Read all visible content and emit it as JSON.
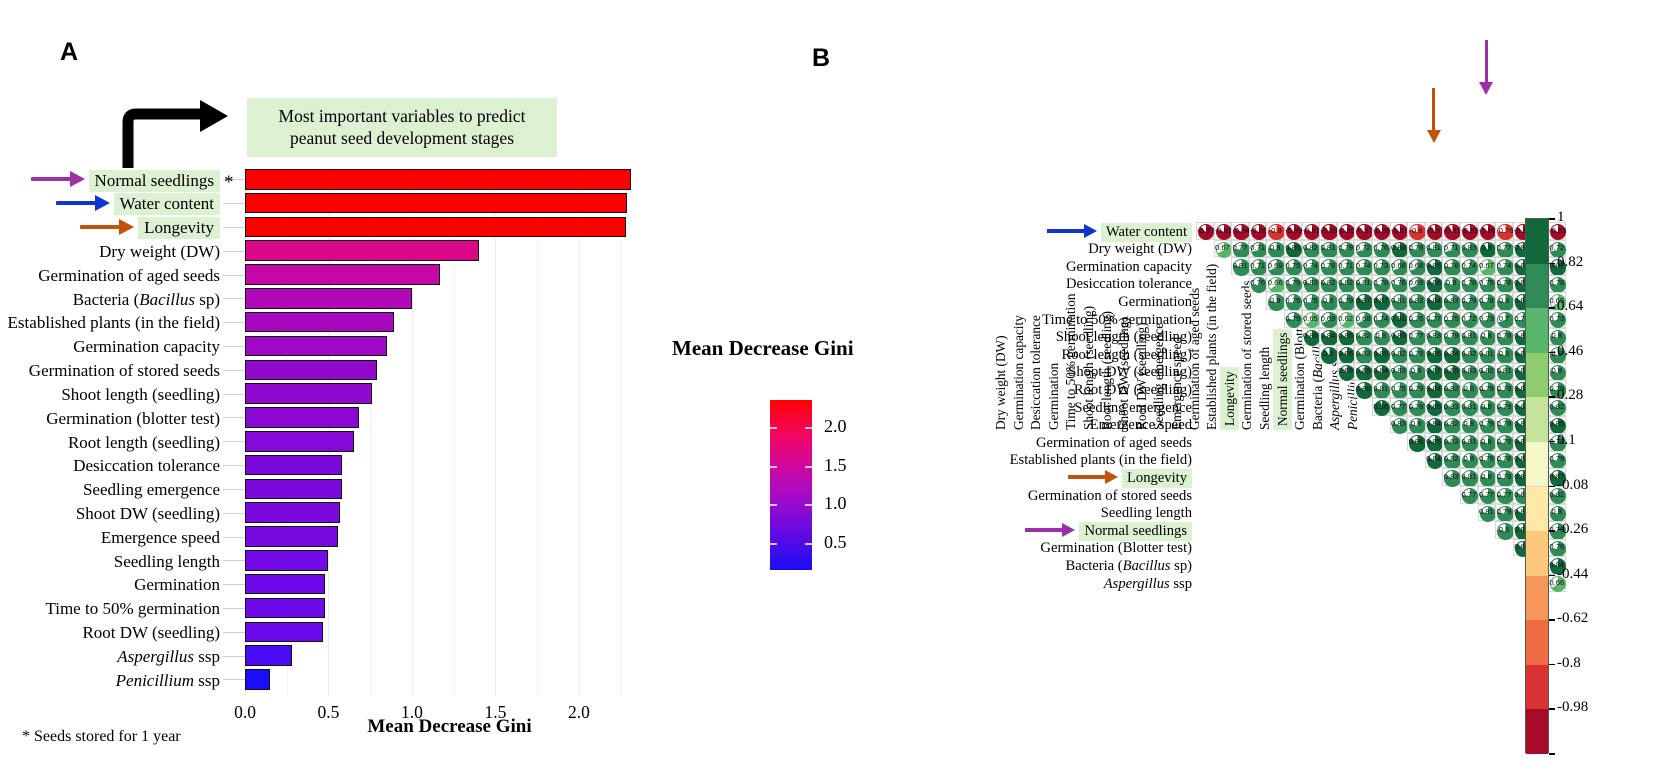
{
  "panelA": {
    "letter": "A",
    "callout_text_line1": "Most important variables to predict",
    "callout_text_line2": "peanut seed development stages",
    "axis_title": "Mean Decrease Gini",
    "footnote": "* Seeds stored for 1 year",
    "asterisk": "*",
    "xticks": [
      "0.0",
      "0.5",
      "1.0",
      "1.5",
      "2.0"
    ],
    "arrows": [
      {
        "name": "purple-arrow-normal-seedlings",
        "color": "#9B30A8"
      },
      {
        "name": "blue-arrow-water-content",
        "color": "#0E35D0"
      },
      {
        "name": "orange-arrow-longevity",
        "color": "#C1520A"
      }
    ]
  },
  "legend": {
    "title": "Mean Decrease Gini",
    "ticks": [
      "2.0",
      "1.5",
      "1.0",
      "0.5"
    ]
  },
  "panelB": {
    "letter": "B",
    "col_headers": [
      "Dry weight (DW)",
      "Germination capacity",
      "Desiccation tolerance",
      "Germination",
      "Time to 50% germination",
      "Shoot length (seedling)",
      "Root length (seedling)",
      "Shoot DW (seedling)",
      "Root DW (seedling)",
      "Seedling emergence",
      "Emergence speed",
      "Germination of aged seeds",
      "Established plants (in the field)",
      "Longevity",
      "Germination of stored seeds",
      "Seedling length",
      "Normal seedlings",
      "Germination (Blotter test)",
      "Bacteria (Bacillus sp)",
      "Aspergillus ssp",
      "Penicillium ssp"
    ],
    "col_header_italic": {
      "18": "Bacillus",
      "19": "Aspergillus",
      "20": "Penicillium"
    },
    "col_highlight": [
      13,
      16
    ],
    "row_labels": [
      "Water content",
      "Dry weight (DW)",
      "Germination capacity",
      "Desiccation tolerance",
      "Germination",
      "Time to 50% germination",
      "Shoot length (seedling)",
      "Root length (seedling)",
      "Shoot DW (seedling)",
      "Root DW (seedling)",
      "Seedling emergence",
      "Emergence speed",
      "Germination of aged seeds",
      "Established plants (in the field)",
      "Longevity",
      "Germination of stored seeds",
      "Seedling length",
      "Normal seedlings",
      "Germination (Blotter test)",
      "Bacteria (Bacillus sp)",
      "Aspergillus ssp"
    ],
    "row_highlight": [
      0,
      14,
      17
    ],
    "arrows": [
      {
        "name": "blue-arrow-water-content-row",
        "color": "#0E35D0"
      },
      {
        "name": "orange-arrow-longevity-row",
        "color": "#C1520A"
      },
      {
        "name": "purple-arrow-normal-seedlings-row",
        "color": "#9B30A8"
      },
      {
        "name": "orange-arrow-longevity-col",
        "color": "#C1520A"
      },
      {
        "name": "purple-arrow-normal-seedlings-col",
        "color": "#9B30A8"
      }
    ],
    "scale_ticks": [
      "1",
      "0.82",
      "0.64",
      "0.46",
      "0.28",
      "0.1",
      "-0.08",
      "-0.26",
      "-0.44",
      "-0.62",
      "-0.8",
      "-0.98"
    ],
    "scale_colors": [
      "#11693B",
      "#2E8B57",
      "#59B56B",
      "#8FCB6F",
      "#C6E39C",
      "#F5F7C6",
      "#FCE9A8",
      "#FBC87C",
      "#F79659",
      "#EE6B43",
      "#D93232",
      "#A50B28"
    ]
  },
  "chart_data": [
    {
      "type": "bar",
      "title": "Most important variables to predict peanut seed development stages",
      "xlabel": "Mean Decrease Gini",
      "ylabel": "",
      "xlim": [
        0,
        2.45
      ],
      "grid": true,
      "orientation": "horizontal",
      "colormap": "blue-purple-red (Mean Decrease Gini)",
      "categories": [
        "Normal seedlings",
        "Water content",
        "Longevity",
        "Dry weight (DW)",
        "Germination of aged seeds",
        "Bacteria (Bacillus sp)",
        "Established plants (in the field)",
        "Germination capacity",
        "Germination of stored seeds",
        "Shoot length (seedling)",
        "Germination (blotter test)",
        "Root length (seedling)",
        "Desiccation tolerance",
        "Seedling emergence",
        "Shoot DW (seedling)",
        "Emergence speed",
        "Seedling length",
        "Germination",
        "Time to 50% germination",
        "Root DW (seedling)",
        "Aspergillus ssp",
        "Penicillium ssp"
      ],
      "values": [
        2.31,
        2.29,
        2.28,
        1.4,
        1.17,
        1.0,
        0.89,
        0.85,
        0.79,
        0.76,
        0.68,
        0.65,
        0.58,
        0.58,
        0.57,
        0.56,
        0.5,
        0.48,
        0.48,
        0.47,
        0.28,
        0.15
      ],
      "bar_colors": [
        "#FF0000",
        "#FF0000",
        "#FF0000",
        "#DA0788",
        "#C408A5",
        "#B009B8",
        "#A609C0",
        "#9C0AC6",
        "#9309CC",
        "#8F09CE",
        "#8A08D2",
        "#8508D6",
        "#7C09DC",
        "#7C09DC",
        "#7A09DE",
        "#7809E0",
        "#7209E6",
        "#6E0AEA",
        "#6E0AEA",
        "#6D0AEB",
        "#4A0BF5",
        "#1B0CFA"
      ]
    },
    {
      "type": "heatmap",
      "subtype": "correlation-pie-matrix",
      "title": "",
      "note": "Upper-triangular correlation matrix rendered as pie glyphs; value printed inside each pie.",
      "scale_range": [
        -0.98,
        1
      ],
      "scale_ticks": [
        1,
        0.82,
        0.64,
        0.46,
        0.28,
        0.1,
        -0.08,
        -0.26,
        -0.44,
        -0.62,
        -0.8,
        -0.98
      ],
      "x": [
        "Dry weight (DW)",
        "Germination capacity",
        "Desiccation tolerance",
        "Germination",
        "Time to 50% germination",
        "Shoot length (seedling)",
        "Root length (seedling)",
        "Shoot DW (seedling)",
        "Root DW (seedling)",
        "Seedling emergence",
        "Emergence speed",
        "Germination of aged seeds",
        "Established plants (in the field)",
        "Longevity",
        "Germination of stored seeds",
        "Seedling length",
        "Normal seedlings",
        "Germination (Blotter test)",
        "Bacteria (Bacillus sp)",
        "Aspergillus ssp",
        "Penicillium ssp"
      ],
      "y": [
        "Water content",
        "Dry weight (DW)",
        "Germination capacity",
        "Desiccation tolerance",
        "Germination",
        "Time to 50% germination",
        "Shoot length (seedling)",
        "Root length (seedling)",
        "Shoot DW (seedling)",
        "Root DW (seedling)",
        "Seedling emergence",
        "Emergence speed",
        "Germination of aged seeds",
        "Established plants (in the field)",
        "Longevity",
        "Germination of stored seeds",
        "Seedling length",
        "Normal seedlings",
        "Germination (Blotter test)",
        "Bacteria (Bacillus sp)",
        "Aspergillus ssp"
      ],
      "values": [
        [
          -0.87,
          -0.82,
          -0.84,
          -0.83,
          -0.8,
          -0.89,
          -0.82,
          -0.89,
          -0.85,
          -0.87,
          -0.86,
          -0.87,
          -0.8,
          -0.9,
          -0.91,
          -0.85,
          -0.88,
          -0.76,
          -0.87,
          -0.65,
          -0.83
        ],
        [
          null,
          0.67,
          0.77,
          0.71,
          0.8,
          0.85,
          0.82,
          0.81,
          0.79,
          0.72,
          0.76,
          0.88,
          0.78,
          0.81,
          0.71,
          0.83,
          0.9,
          0.77,
          0.89,
          0.56,
          0.72
        ],
        [
          null,
          null,
          0.81,
          0.71,
          0.69,
          0.75,
          0.74,
          0.76,
          0.71,
          0.74,
          0.73,
          0.68,
          0.68,
          0.85,
          0.78,
          0.74,
          0.67,
          0.74,
          0.84,
          0.41,
          0.87
        ],
        [
          null,
          null,
          null,
          0.76,
          0.66,
          0.79,
          0.83,
          0.82,
          0.82,
          0.81,
          0.78,
          0.76,
          0.69,
          0.86,
          0.8,
          0.78,
          0.75,
          0.78,
          0.87,
          0.45,
          0.78
        ],
        [
          null,
          null,
          null,
          null,
          0.8,
          0.75,
          0.75,
          0.8,
          0.79,
          0.87,
          0.87,
          0.81,
          0.82,
          0.84,
          0.83,
          0.79,
          0.78,
          0.8,
          0.85,
          0.63,
          0.65
        ],
        [
          null,
          null,
          null,
          null,
          null,
          0.79,
          0.65,
          0.69,
          0.62,
          0.68,
          0.74,
          0.91,
          0.76,
          0.77,
          0.75,
          0.72,
          0.73,
          0.7,
          0.75,
          0.57,
          0.73
        ],
        [
          null,
          null,
          null,
          null,
          null,
          null,
          0.86,
          0.84,
          0.85,
          0.82,
          0.8,
          0.85,
          0.77,
          0.83,
          0.79,
          0.81,
          0.8,
          0.78,
          0.84,
          0.61,
          0.8
        ],
        [
          null,
          null,
          null,
          null,
          null,
          null,
          null,
          0.9,
          0.86,
          0.83,
          0.85,
          0.82,
          0.79,
          0.86,
          0.84,
          0.82,
          0.81,
          0.8,
          0.84,
          0.58,
          0.8
        ],
        [
          null,
          null,
          null,
          null,
          null,
          null,
          null,
          null,
          0.88,
          0.85,
          0.84,
          0.83,
          0.8,
          0.87,
          0.85,
          0.83,
          0.82,
          0.81,
          0.85,
          0.56,
          0.8
        ],
        [
          null,
          null,
          null,
          null,
          null,
          null,
          null,
          null,
          null,
          0.86,
          0.81,
          0.75,
          0.79,
          0.84,
          0.82,
          0.8,
          0.79,
          0.78,
          0.84,
          0.55,
          0.79
        ],
        [
          null,
          null,
          null,
          null,
          null,
          null,
          null,
          null,
          null,
          null,
          0.96,
          0.77,
          0.78,
          0.85,
          0.83,
          0.81,
          0.8,
          0.79,
          0.84,
          0.55,
          0.82
        ],
        [
          null,
          null,
          null,
          null,
          null,
          null,
          null,
          null,
          null,
          null,
          null,
          0.83,
          0.8,
          0.84,
          0.82,
          0.8,
          0.79,
          0.78,
          0.85,
          0.63,
          0.85
        ],
        [
          null,
          null,
          null,
          null,
          null,
          null,
          null,
          null,
          null,
          null,
          null,
          null,
          0.86,
          0.85,
          0.83,
          0.81,
          0.8,
          0.79,
          0.85,
          0.64,
          0.78
        ],
        [
          null,
          null,
          null,
          null,
          null,
          null,
          null,
          null,
          null,
          null,
          null,
          null,
          null,
          0.84,
          0.82,
          0.8,
          0.79,
          0.78,
          0.87,
          0.57,
          0.79
        ],
        [
          null,
          null,
          null,
          null,
          null,
          null,
          null,
          null,
          null,
          null,
          null,
          null,
          null,
          null,
          0.83,
          0.81,
          0.8,
          0.78,
          0.89,
          0.62,
          0.87
        ],
        [
          null,
          null,
          null,
          null,
          null,
          null,
          null,
          null,
          null,
          null,
          null,
          null,
          null,
          null,
          null,
          0.77,
          0.77,
          0.77,
          0.83,
          0.66,
          0.82
        ],
        [
          null,
          null,
          null,
          null,
          null,
          null,
          null,
          null,
          null,
          null,
          null,
          null,
          null,
          null,
          null,
          null,
          0.81,
          0.79,
          0.84,
          0.86,
          0.8
        ],
        [
          null,
          null,
          null,
          null,
          null,
          null,
          null,
          null,
          null,
          null,
          null,
          null,
          null,
          null,
          null,
          null,
          null,
          0.8,
          0.89,
          0.66,
          0.79
        ],
        [
          null,
          null,
          null,
          null,
          null,
          null,
          null,
          null,
          null,
          null,
          null,
          null,
          null,
          null,
          null,
          null,
          null,
          null,
          0.88,
          0.56,
          0.76
        ],
        [
          null,
          null,
          null,
          null,
          null,
          null,
          null,
          null,
          null,
          null,
          null,
          null,
          null,
          null,
          null,
          null,
          null,
          null,
          null,
          0.58,
          0.84
        ],
        [
          null,
          null,
          null,
          null,
          null,
          null,
          null,
          null,
          null,
          null,
          null,
          null,
          null,
          null,
          null,
          null,
          null,
          null,
          null,
          null,
          0.66
        ]
      ]
    }
  ]
}
